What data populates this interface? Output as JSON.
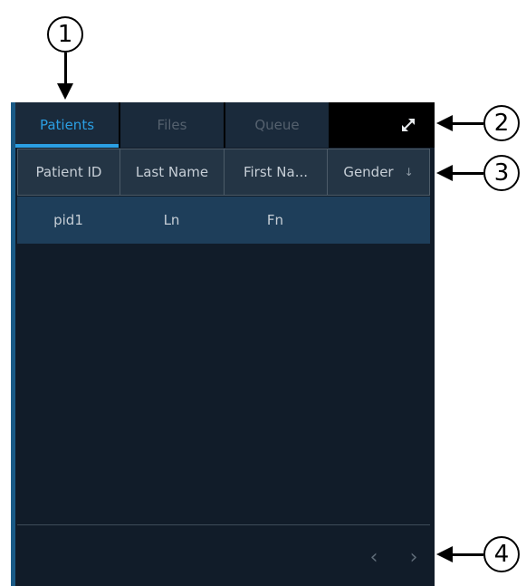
{
  "callouts": [
    {
      "label": "1"
    },
    {
      "label": "2"
    },
    {
      "label": "3"
    },
    {
      "label": "4"
    }
  ],
  "tabs": [
    {
      "label": "Patients",
      "active": true
    },
    {
      "label": "Files",
      "active": false
    },
    {
      "label": "Queue",
      "active": false
    }
  ],
  "toolbar": {
    "expand_icon": "expand-icon"
  },
  "table": {
    "columns": [
      "Patient ID",
      "Last Name",
      "First Na...",
      "Gender"
    ],
    "sort_icon": "sort-down-icon",
    "rows": [
      {
        "patient_id": "pid1",
        "last_name": "Ln",
        "first_name": "Fn",
        "gender": ""
      }
    ]
  },
  "pager": {
    "prev": "‹",
    "next": "›"
  },
  "colors": {
    "panel_bg": "#111c29",
    "tab_active": "#2b9fe3",
    "selected_row": "#1e3e5a",
    "header_bg": "#243545"
  }
}
